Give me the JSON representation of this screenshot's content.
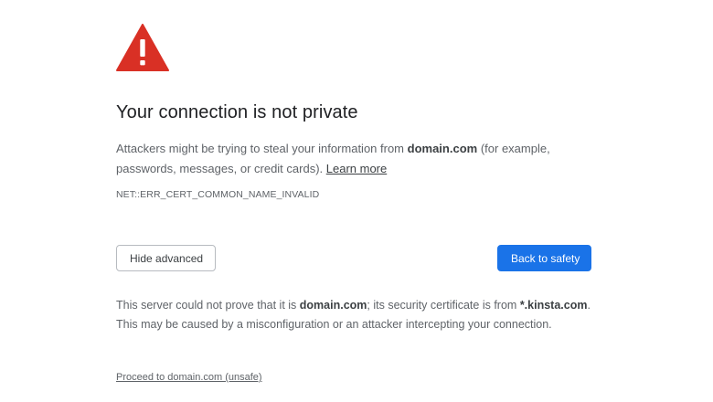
{
  "icons": {
    "warning": "warning-triangle-icon",
    "warning_color": "#d93025"
  },
  "main": {
    "title": "Your connection is not private",
    "explanation": {
      "prefix": "Attackers might be trying to steal your information from ",
      "domain": "domain.com",
      "suffix": " (for example, passwords, messages, or credit cards). ",
      "learn_more": "Learn more"
    },
    "error_code": "NET::ERR_CERT_COMMON_NAME_INVALID"
  },
  "buttons": {
    "hide_advanced": "Hide advanced",
    "back_to_safety": "Back to safety",
    "primary_color": "#1a73e8"
  },
  "details": {
    "part1": "This server could not prove that it is ",
    "domain": "domain.com",
    "part2": "; its security certificate is from ",
    "cert_domain": "*.kinsta.com",
    "part3": ". This may be caused by a misconfiguration or an attacker intercepting your connection."
  },
  "proceed": {
    "link": "Proceed to domain.com (unsafe)"
  }
}
